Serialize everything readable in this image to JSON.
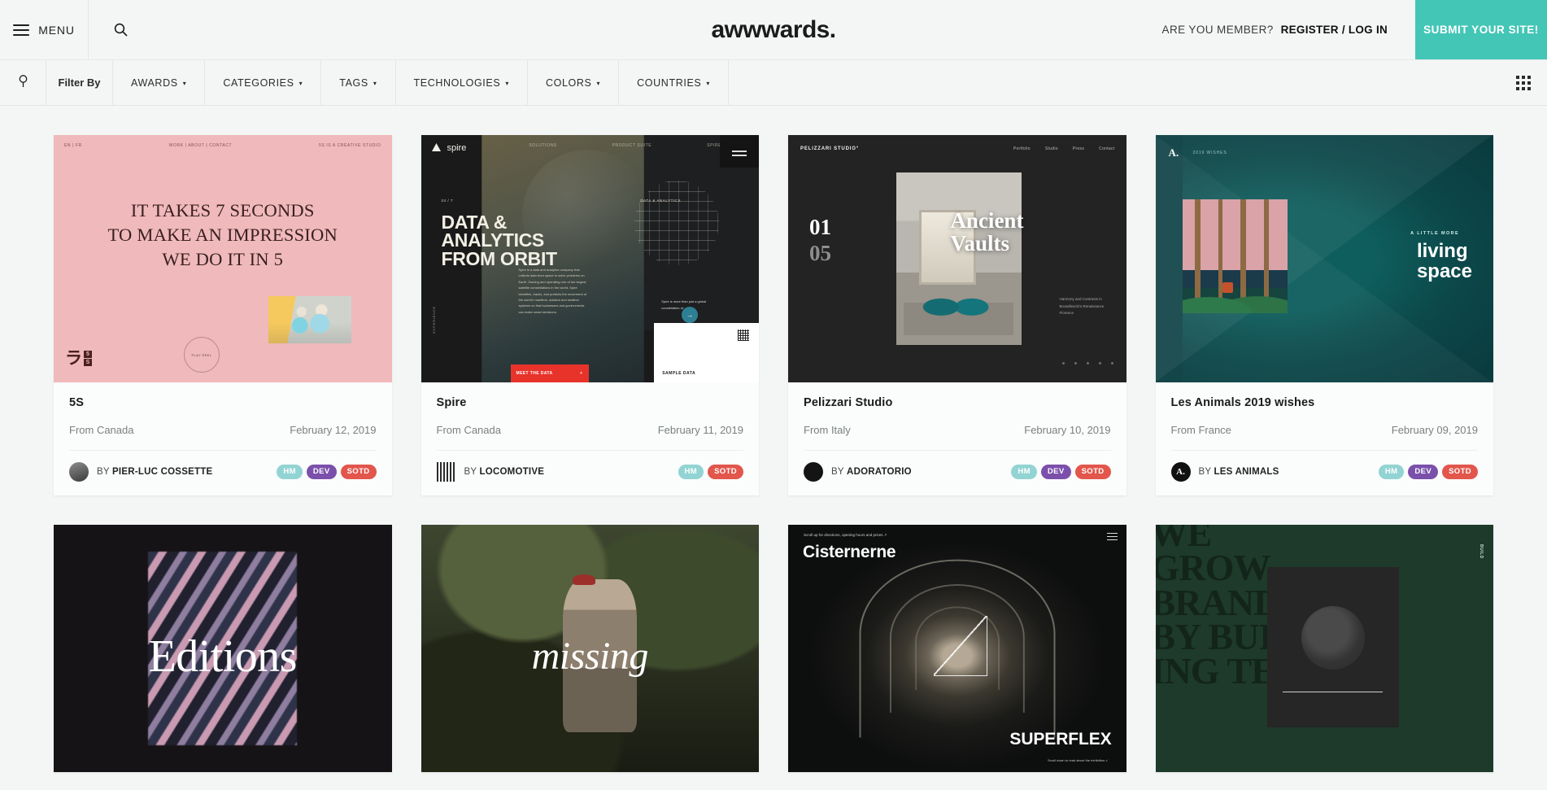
{
  "header": {
    "menu_label": "MENU",
    "menu_icon": "hamburger-icon",
    "search_icon": "search-icon",
    "logo": "awwwards.",
    "member_question": "ARE YOU MEMBER?",
    "member_link": "REGISTER / LOG IN",
    "submit_button": "SUBMIT YOUR SITE!",
    "accent_color": "#44c6b7"
  },
  "filterbar": {
    "filter_icon": "funnel-icon",
    "filter_by": "Filter By",
    "items": [
      {
        "label": "AWARDS",
        "caret": "▾"
      },
      {
        "label": "CATEGORIES",
        "caret": "▾"
      },
      {
        "label": "TAGS",
        "caret": "▾"
      },
      {
        "label": "TECHNOLOGIES",
        "caret": "▾"
      },
      {
        "label": "COLORS",
        "caret": "▾"
      },
      {
        "label": "COUNTRIES",
        "caret": "▾"
      }
    ],
    "grid_toggle_icon": "grid-view-icon"
  },
  "badge_colors": {
    "hm": "#92d4d3",
    "dev": "#7b50ab",
    "sotd": "#e2564c"
  },
  "cards": [
    {
      "title": "5S",
      "country": "From Canada",
      "date": "February 12, 2019",
      "by_prefix": "BY",
      "author": "PIER-LUC COSSETTE",
      "avatar_icon": "author-photo-avatar",
      "avatar_initial": "",
      "badges": [
        "HM",
        "DEV",
        "SOTD"
      ],
      "thumb": {
        "nav_left": "EN | FR",
        "nav_center": "WORK | ABOUT | CONTACT",
        "nav_right": "5S IS A CREATIVE STUDIO",
        "headline_line1": "IT TAKES 7 SECONDS",
        "headline_line2": "TO MAKE AN IMPRESSION",
        "headline_line3": "WE DO IT IN 5",
        "circle_label": "PLAY REEL",
        "logo_mark": "ラ",
        "logo_5": "5",
        "logo_s": "S"
      }
    },
    {
      "title": "Spire",
      "country": "From Canada",
      "date": "February 11, 2019",
      "by_prefix": "BY",
      "author": "LOCOMOTIVE",
      "avatar_icon": "barcode-avatar",
      "avatar_initial": "",
      "badges": [
        "HM",
        "SOTD"
      ],
      "thumb": {
        "brand": "spire",
        "nav_a": "SOLUTIONS",
        "nav_b": "PRODUCT SUITE",
        "nav_c": "SPIRE",
        "tag_left": "24 / 7",
        "tag_right": "DATA & ANALYTICS",
        "headline_line1": "DATA &",
        "headline_line2": "ANALYTICS",
        "headline_line3": "FROM ORBIT",
        "paragraph": "Spire is a data and analytics company that collects data from space to solve problems on Earth. Owning and operating one of the largest satellite constellations in the world, Spire identifies, tracks, and predicts the movement of the world's maritime, aviation and weather systems so that businesses and governments can make smart decisions.",
        "cta": "MEET THE DATA",
        "cta_plus": "+",
        "sample": "SAMPLE DATA",
        "right_caption": "Spire is more than just a global constellation of",
        "vertical": "EXPERIENCE"
      }
    },
    {
      "title": "Pelizzari Studio",
      "country": "From Italy",
      "date": "February 10, 2019",
      "by_prefix": "BY",
      "author": "ADORATORIO",
      "avatar_icon": "dark-circle-avatar",
      "avatar_initial": "",
      "badges": [
        "HM",
        "DEV",
        "SOTD"
      ],
      "thumb": {
        "brand": "PELIZZARI STUDIO°",
        "nav": [
          "Portfolio",
          "Studio",
          "Press",
          "Contact"
        ],
        "number_current": "01",
        "number_total": "05",
        "headline_line1": "Ancient",
        "headline_line2": "Vaults",
        "caption": "Harmony and Contrasts in Brunelleschi's Renaissance Florence"
      }
    },
    {
      "title": "Les Animals 2019 wishes",
      "country": "From France",
      "date": "February 09, 2019",
      "by_prefix": "BY",
      "author": "LES ANIMALS",
      "avatar_icon": "letter-a-avatar",
      "avatar_initial": "A.",
      "badges": [
        "HM",
        "DEV",
        "SOTD"
      ],
      "thumb": {
        "logo": "A.",
        "sub": "2019 WISHES",
        "kicker": "A LITTLE MORE",
        "headline_line1": "living",
        "headline_line2": "space"
      }
    },
    {
      "title": "",
      "country": "",
      "date": "",
      "by_prefix": "",
      "author": "",
      "avatar_icon": "",
      "avatar_initial": "",
      "badges": [],
      "thumb": {
        "headline_line1": "Editions"
      }
    },
    {
      "title": "",
      "country": "",
      "date": "",
      "by_prefix": "",
      "author": "",
      "avatar_icon": "",
      "avatar_initial": "",
      "badges": [],
      "thumb": {
        "headline_line1": "missing"
      }
    },
    {
      "title": "",
      "country": "",
      "date": "",
      "by_prefix": "",
      "author": "",
      "avatar_icon": "",
      "avatar_initial": "",
      "badges": [],
      "thumb": {
        "headline_line1": "Cisternerne",
        "brand": "SUPERFLEX",
        "top_note": "Scroll up for directions, opening hours and prices  ↗",
        "bottom_note": "Scroll down to read about the exhibition  ↙"
      }
    },
    {
      "title": "",
      "country": "",
      "date": "",
      "by_prefix": "",
      "author": "",
      "avatar_icon": "",
      "avatar_initial": "",
      "badges": [],
      "thumb": {
        "headline_line1": "WE",
        "headline_line2": "GROW",
        "headline_line3": "BRANDS",
        "headline_line4": "BY BUILD-",
        "headline_line5": "ING TECH",
        "vertical": "BUILD"
      }
    }
  ]
}
